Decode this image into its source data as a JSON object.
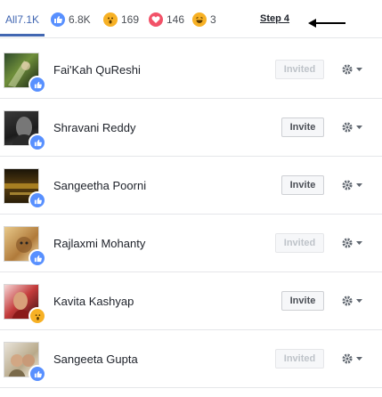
{
  "tabs": {
    "all_label": "All",
    "all_count": "7.1K",
    "like_count": "6.8K",
    "wow_count": "169",
    "love_count": "146",
    "haha_count": "3"
  },
  "annotation": {
    "step_label": "Step 4"
  },
  "people": [
    {
      "name": "Fai'Kah QuReshi",
      "action": "Invited",
      "reaction": "like-icon"
    },
    {
      "name": "Shravani Reddy",
      "action": "Invite",
      "reaction": "like-icon"
    },
    {
      "name": "Sangeetha Poorni",
      "action": "Invite",
      "reaction": "like-icon"
    },
    {
      "name": "Rajlaxmi Mohanty",
      "action": "Invited",
      "reaction": "like-icon"
    },
    {
      "name": "Kavita Kashyap",
      "action": "Invite",
      "reaction": "wow-icon"
    },
    {
      "name": "Sangeeta Gupta",
      "action": "Invited",
      "reaction": "like-icon"
    }
  ],
  "colors": {
    "accent": "#4267b2",
    "like": "#5890ff",
    "love": "#f25268",
    "reaction_yellow": "#f7b125"
  }
}
